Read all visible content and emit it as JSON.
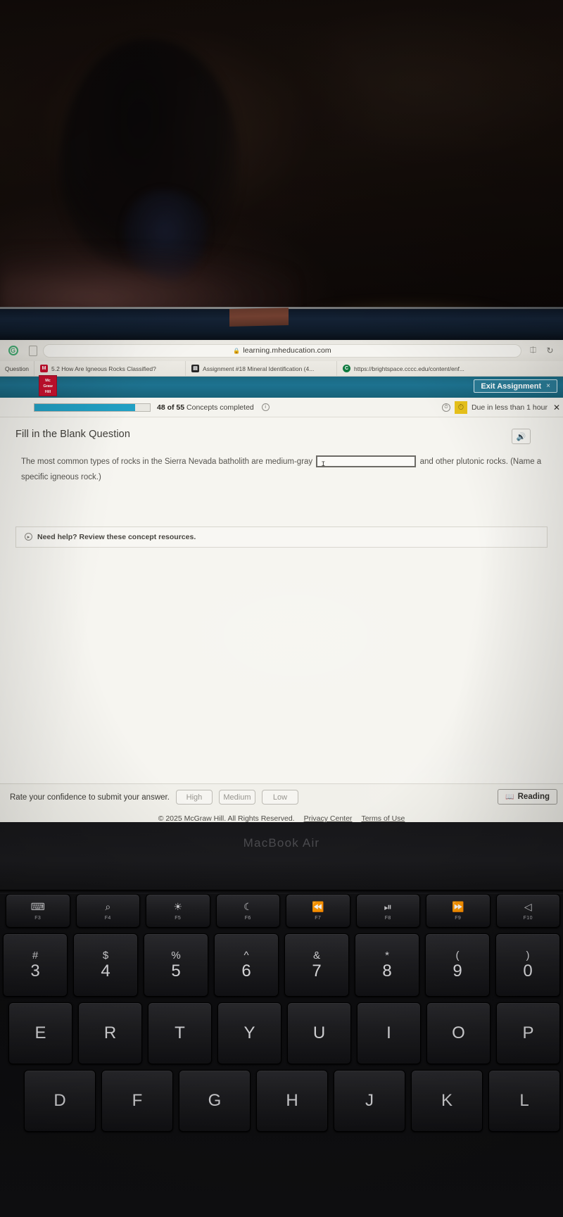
{
  "browser": {
    "address": "learning.mheducation.com",
    "lock_icon": "lock-icon",
    "back_icon": "back-arrow-icon",
    "reload_icon": "reload-icon",
    "share_icon": "share-icon",
    "sidebar_icon": "sidebar-toggle-icon",
    "profile_icon": "profile-icon",
    "tabstrip_label": "Question",
    "tabs": [
      {
        "favicon": "mcgraw-hill-favicon",
        "fav_text": "M",
        "title": "5.2 How Are Igneous Rocks Classified?"
      },
      {
        "favicon": "document-favicon",
        "fav_text": "▤",
        "title": "Assignment #18 Mineral Identification (4..."
      },
      {
        "favicon": "brightspace-favicon",
        "fav_text": "C",
        "title": "https://brightspace.cccc.edu/content/enf..."
      }
    ]
  },
  "app_header": {
    "logo_line1": "Mc",
    "logo_line2": "Graw",
    "logo_line3": "Hill",
    "exit_label": "Exit Assignment",
    "exit_close": "×",
    "bg_color": "#1d7290"
  },
  "progress": {
    "completed": 48,
    "total": 55,
    "percent": 87,
    "count_label": "48 of 55",
    "suffix_label": " Concepts completed",
    "info_icon": "info-icon",
    "bar_color": "#21a0c4",
    "clock_icon": "clock-icon",
    "due_badge_icon": "alert-clock-icon",
    "due_badge_color": "#e8c21a",
    "due_text": "Due in less than 1 hour",
    "due_close": "✕"
  },
  "question": {
    "type_title": "Fill in the Blank Question",
    "speaker_icon": "speaker-icon",
    "text_before": "The most common types of rocks in the Sierra Nevada batholith are medium-gray",
    "text_after": "and other plutonic rocks. (Name a specific igneous rock.)",
    "blank_value": "",
    "blank_caret": "I",
    "help_icon": "chevron-right-circle-icon",
    "help_text": "Need help? Review these concept resources."
  },
  "confidence": {
    "prompt": "Rate your confidence to submit your answer.",
    "options": [
      "High",
      "Medium",
      "Low"
    ],
    "reading_icon": "book-icon",
    "reading_label": "Reading"
  },
  "footer": {
    "copyright": "© 2025 McGraw Hill. All Rights Reserved.",
    "links": [
      "Privacy Center",
      "Terms of Use"
    ]
  },
  "laptop": {
    "brand": "MacBook Air",
    "function_keys": [
      {
        "glyph": "⌨",
        "name": "F3"
      },
      {
        "glyph": "⌕",
        "name": "F4"
      },
      {
        "glyph": "☀",
        "name": "F5"
      },
      {
        "glyph": "☾",
        "name": "F6"
      },
      {
        "glyph": "⏪",
        "name": "F7"
      },
      {
        "glyph": "⏯",
        "name": "F8"
      },
      {
        "glyph": "⏩",
        "name": "F9"
      },
      {
        "glyph": "◁",
        "name": "F10"
      }
    ],
    "number_row": [
      {
        "symbol": "#",
        "digit": "3"
      },
      {
        "symbol": "$",
        "digit": "4"
      },
      {
        "symbol": "%",
        "digit": "5"
      },
      {
        "symbol": "^",
        "digit": "6"
      },
      {
        "symbol": "&",
        "digit": "7"
      },
      {
        "symbol": "*",
        "digit": "8"
      },
      {
        "symbol": "(",
        "digit": "9"
      },
      {
        "symbol": ")",
        "digit": "0"
      }
    ],
    "letter_row_q": [
      "E",
      "R",
      "T",
      "Y",
      "U",
      "I",
      "O",
      "P"
    ],
    "letter_row_a": [
      "D",
      "F",
      "G",
      "H",
      "J",
      "K",
      "L"
    ]
  }
}
